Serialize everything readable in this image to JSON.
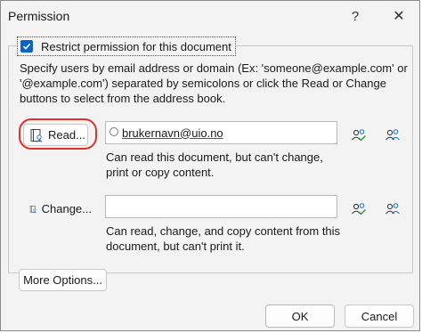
{
  "dialog": {
    "title": "Permission",
    "help_glyph": "?",
    "close_glyph": "✕"
  },
  "restrict": {
    "checked": true,
    "label": "Restrict permission for this document"
  },
  "instructions": "Specify users by email address or domain (Ex: 'someone@example.com' or '@example.com') separated by semicolons or click the Read or Change buttons to select from the address book.",
  "read": {
    "button_label": "Read...",
    "value": "brukernavn@uio.no",
    "description": "Can read this document, but can't change, print or copy content."
  },
  "change": {
    "button_label": "Change...",
    "value": "",
    "description": "Can read, change, and copy content from this document, but can't print it."
  },
  "buttons": {
    "more_options": "More Options...",
    "ok": "OK",
    "cancel": "Cancel"
  },
  "colors": {
    "accent": "#0a64c8",
    "highlight_ring": "#e0302a"
  }
}
